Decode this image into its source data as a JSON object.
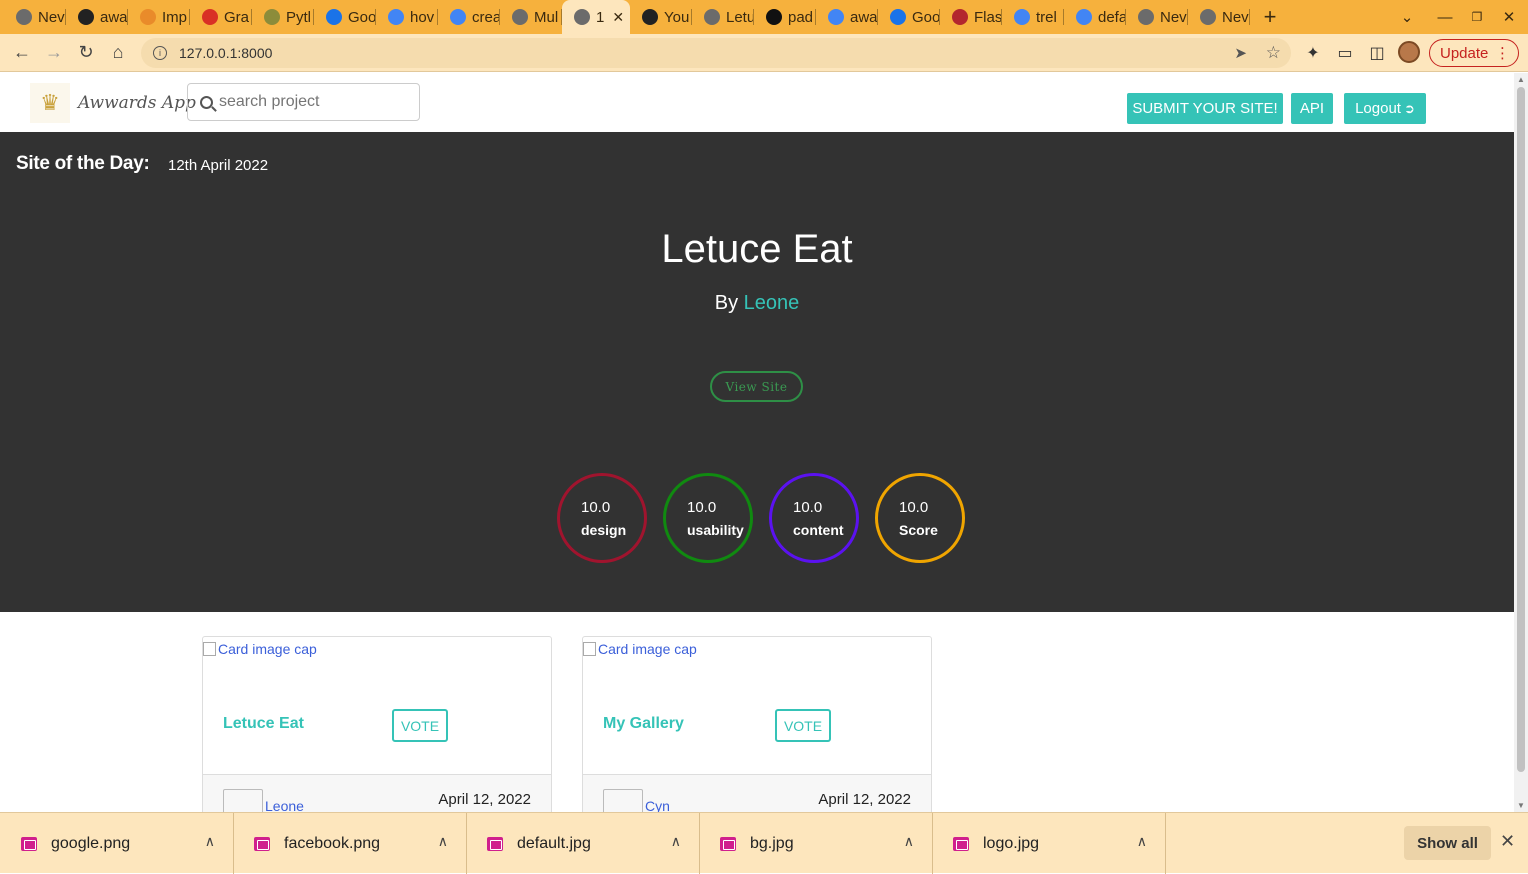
{
  "browser": {
    "tabs": [
      {
        "label": "Nev",
        "icon": "chrome-icon",
        "color": "#6b6b6b"
      },
      {
        "label": "awa",
        "icon": "github-icon",
        "color": "#222222"
      },
      {
        "label": "Imp",
        "icon": "stack-icon",
        "color": "#e98b2a"
      },
      {
        "label": "Gra",
        "icon": "gmail-icon",
        "color": "#d93025"
      },
      {
        "label": "Pytl",
        "icon": "tree-icon",
        "color": "#8c8c3a"
      },
      {
        "label": "Goo",
        "icon": "analytics-icon",
        "color": "#1a73e8"
      },
      {
        "label": "hov",
        "icon": "google-icon",
        "color": "#4285f4"
      },
      {
        "label": "crea",
        "icon": "google-icon",
        "color": "#4285f4"
      },
      {
        "label": "Mul",
        "icon": "globe-icon",
        "color": "#6b6b6b"
      },
      {
        "label": "1",
        "icon": "globe-icon",
        "color": "#6b6b6b",
        "active": true
      },
      {
        "label": "You",
        "icon": "github-icon",
        "color": "#222222"
      },
      {
        "label": "Letu",
        "icon": "globe-icon",
        "color": "#6b6b6b"
      },
      {
        "label": "pad",
        "icon": "medium-icon",
        "color": "#111111"
      },
      {
        "label": "awa",
        "icon": "google-icon",
        "color": "#4285f4"
      },
      {
        "label": "Goo",
        "icon": "analytics-icon",
        "color": "#1a73e8"
      },
      {
        "label": "Flas",
        "icon": "flask-icon",
        "color": "#b3262e"
      },
      {
        "label": "trel",
        "icon": "google-icon",
        "color": "#4285f4"
      },
      {
        "label": "defa",
        "icon": "google-icon",
        "color": "#4285f4"
      },
      {
        "label": "Nev",
        "icon": "chrome-icon",
        "color": "#6b6b6b"
      },
      {
        "label": "Nev",
        "icon": "chrome-icon",
        "color": "#6b6b6b"
      }
    ],
    "url": "127.0.0.1:8000",
    "update_label": "Update"
  },
  "navbar": {
    "brand": "Awwards App",
    "search_placeholder": "search project",
    "submit_label": "SUBMIT YOUR SITE!",
    "api_label": "API",
    "logout_label": "Logout",
    "accent": "#35c3b7"
  },
  "hero": {
    "heading": "Site of the Day:",
    "date": "12th April 2022",
    "title": "Letuce Eat",
    "by": "By",
    "author": "Leone",
    "view_label": "View Site",
    "ratings": [
      {
        "value": "10.0",
        "label": "design",
        "color": "#a0142e"
      },
      {
        "value": "10.0",
        "label": "usability",
        "color": "#108a10"
      },
      {
        "value": "10.0",
        "label": "content",
        "color": "#5b12f0"
      },
      {
        "value": "10.0",
        "label": "Score",
        "color": "#f0a500"
      }
    ]
  },
  "cards": [
    {
      "image_alt": "Card image cap",
      "title": "Letuce Eat",
      "vote_label": "VOTE",
      "user": "Leone",
      "date": "April 12, 2022"
    },
    {
      "image_alt": "Card image cap",
      "title": "My Gallery",
      "vote_label": "VOTE",
      "user": "Cyn",
      "date": "April 12, 2022"
    }
  ],
  "downloads": {
    "files": [
      "google.png",
      "facebook.png",
      "default.jpg",
      "bg.jpg",
      "logo.jpg"
    ],
    "show_all_label": "Show all"
  }
}
